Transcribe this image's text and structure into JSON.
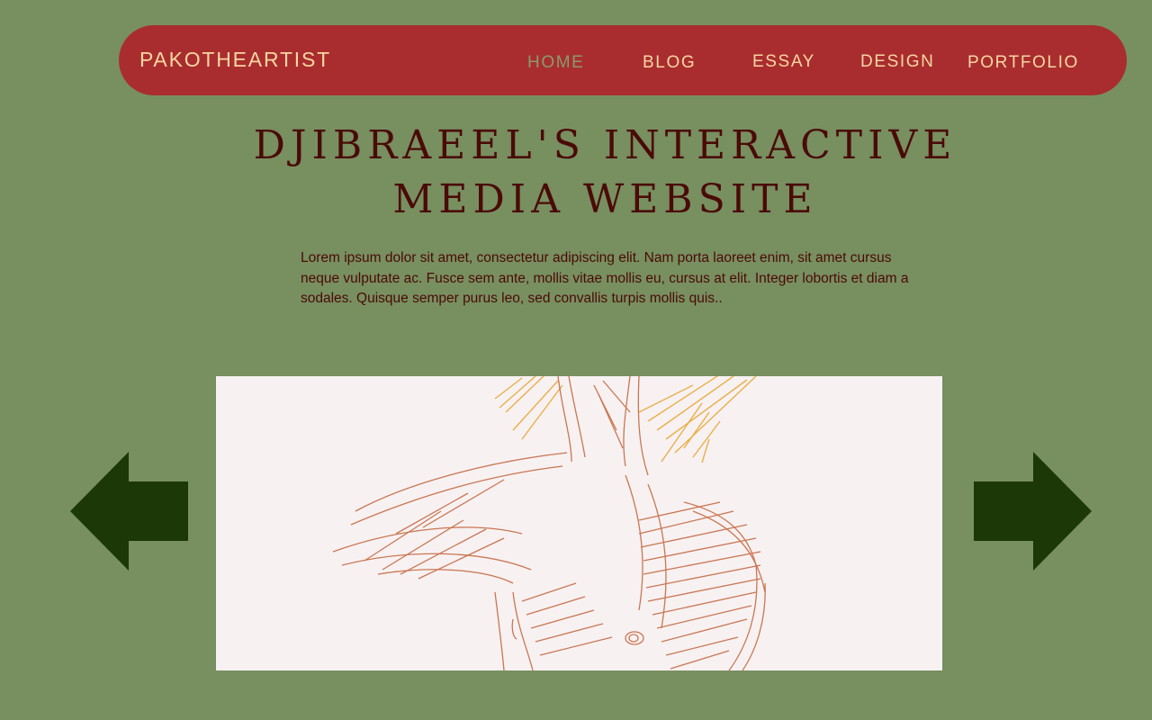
{
  "nav": {
    "brand": "PAKOTHEARTIST",
    "links": [
      {
        "label": "HOME",
        "active": true
      },
      {
        "label": "BLOG",
        "active": false
      },
      {
        "label": "ESSAY",
        "active": false
      },
      {
        "label": "DESIGN",
        "active": false
      },
      {
        "label": "PORTFOLIO",
        "active": false
      }
    ]
  },
  "hero": {
    "title_line1": "DJIBRAEEL'S INTERACTIVE",
    "title_line2": "MEDIA WEBSITE",
    "intro": "Lorem ipsum dolor sit amet, consectetur adipiscing elit. Nam porta laoreet enim, sit amet cursus neque vulputate ac. Fusce sem ante, mollis vitae mollis eu, cursus at elit. Integer lobortis et diam a sodales. Quisque semper purus leo, sed convallis turpis mollis quis.."
  },
  "carousel": {
    "prev_icon": "arrow-left-icon",
    "next_icon": "arrow-right-icon",
    "image_icon": "sketch-artwork"
  },
  "colors": {
    "background": "#788f60",
    "navbar": "#a92d2f",
    "nav_text": "#f7d7a1",
    "nav_active": "#8a9a6e",
    "title": "#4a0a07",
    "arrow": "#1c3807",
    "image_bg": "#f7f1f2"
  }
}
